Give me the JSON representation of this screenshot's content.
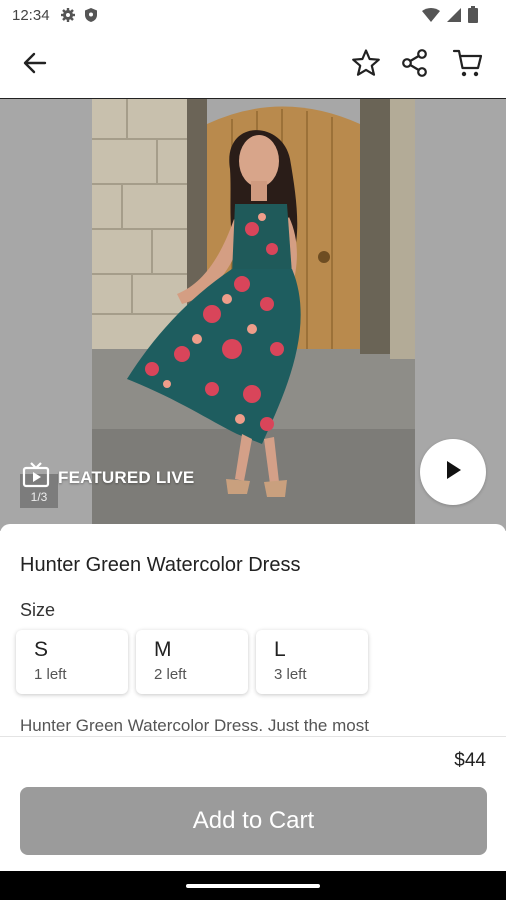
{
  "status_bar": {
    "time": "12:34",
    "icons_left": [
      "settings-icon",
      "shield-icon"
    ],
    "icons_right": [
      "wifi-icon",
      "signal-icon",
      "battery-icon"
    ]
  },
  "app_bar": {
    "actions": [
      "back-arrow-icon",
      "star-icon",
      "share-icon",
      "cart-icon"
    ]
  },
  "hero": {
    "featured_label": "FEATURED LIVE",
    "counter": "1/3",
    "icons": [
      "tv-icon",
      "play-icon"
    ]
  },
  "product": {
    "title": "Hunter Green Watercolor Dress",
    "size_label": "Size",
    "sizes": [
      {
        "name": "S",
        "stock": "1 left"
      },
      {
        "name": "M",
        "stock": "2 left"
      },
      {
        "name": "L",
        "stock": "3 left"
      }
    ],
    "description": "Hunter Green Watercolor Dress. Just the most",
    "price": "$44",
    "add_to_cart_label": "Add to Cart"
  },
  "colors": {
    "button_disabled": "#9b9b9b",
    "hero_background": "#a7a7a7"
  }
}
